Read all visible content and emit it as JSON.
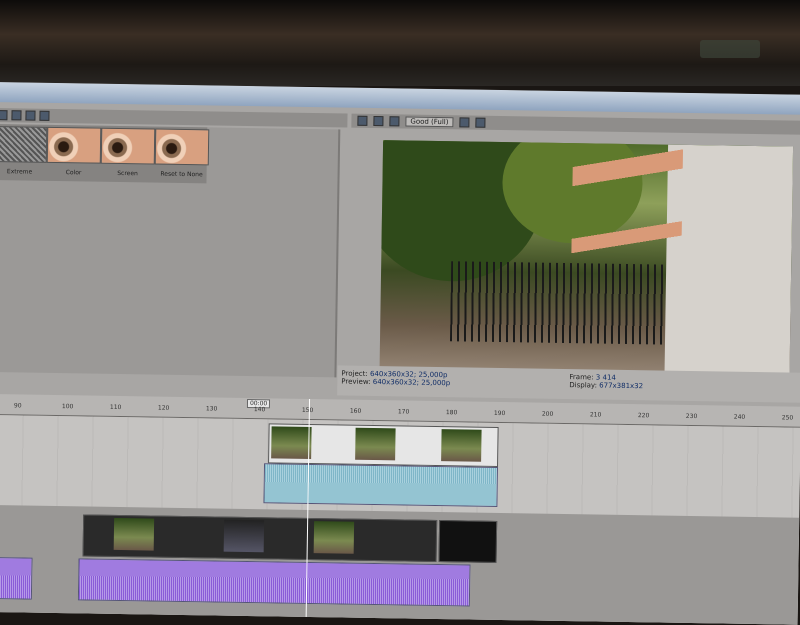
{
  "fx_panel": {
    "items": [
      {
        "label": "Extreme"
      },
      {
        "label": "Color"
      },
      {
        "label": "Screen"
      },
      {
        "label": "Reset to None"
      }
    ]
  },
  "preview": {
    "quality": "Good (Full)",
    "project_label": "Project:",
    "project_value": "640x360x32; 25,000p",
    "preview_label": "Preview:",
    "preview_value": "640x360x32; 25,000p",
    "frame_label": "Frame:",
    "frame_value": "3 414",
    "display_label": "Display:",
    "display_value": "677x381x32"
  },
  "timeline": {
    "badge": "00:00",
    "ticks": [
      "90",
      "100",
      "110",
      "120",
      "130",
      "140",
      "150",
      "160",
      "170",
      "180",
      "190",
      "200",
      "210",
      "220",
      "230",
      "240",
      "250"
    ]
  }
}
